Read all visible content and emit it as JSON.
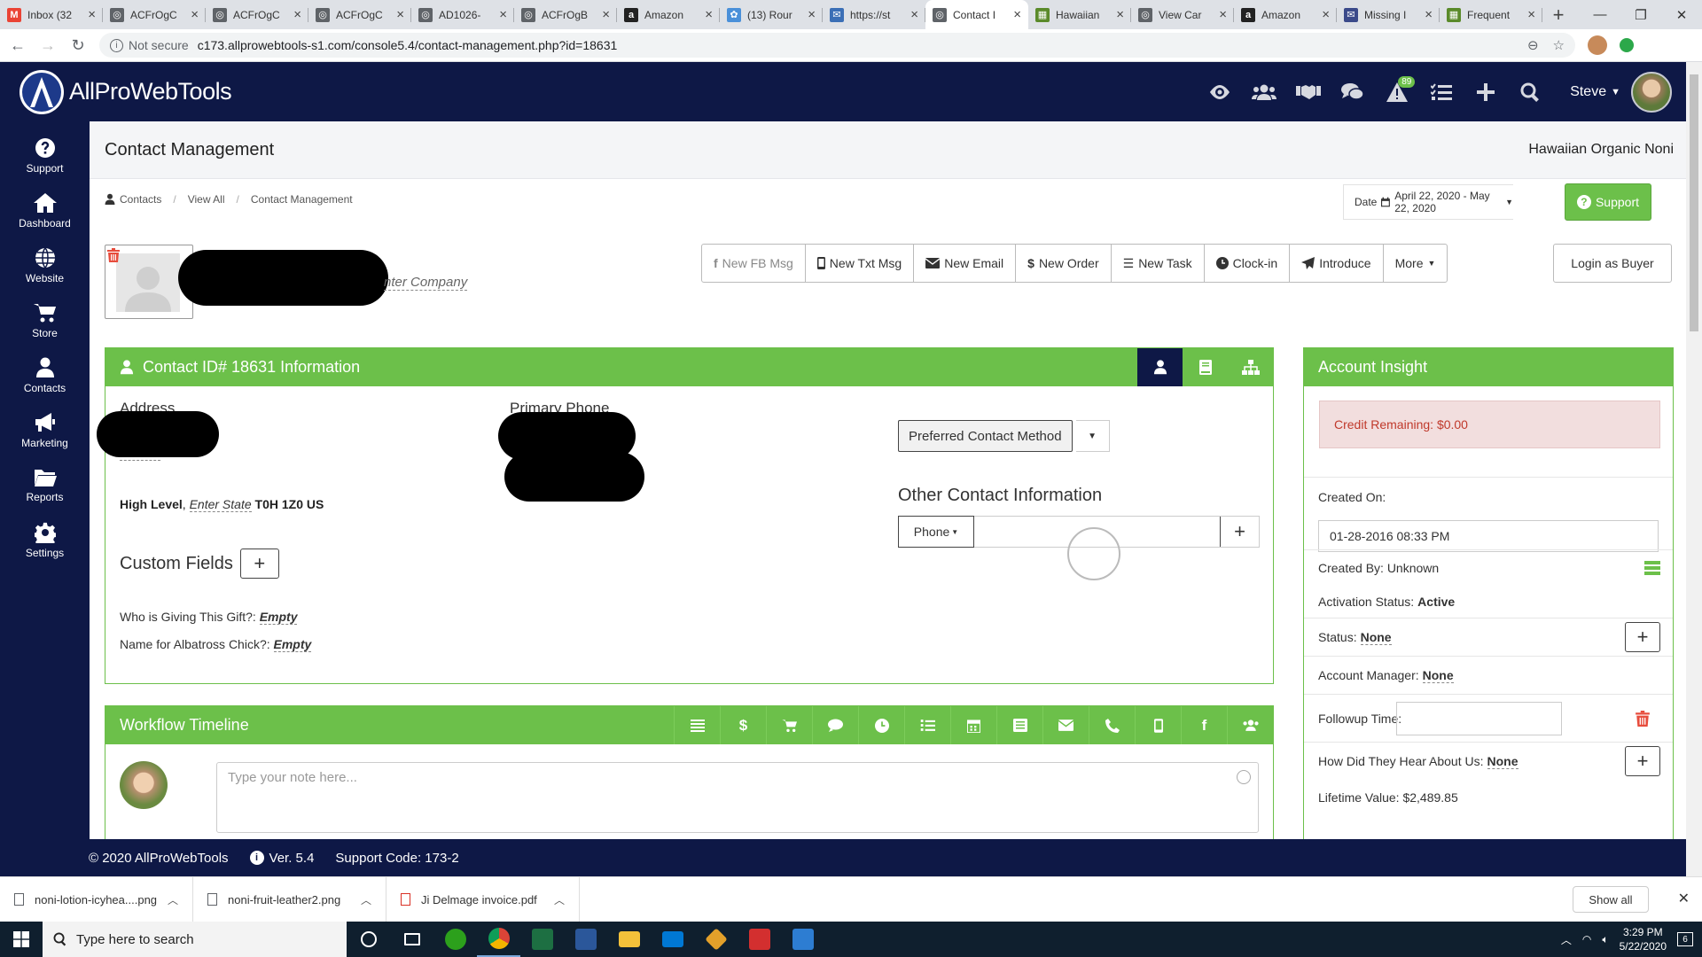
{
  "browser": {
    "tabs": [
      {
        "label": "Inbox (32",
        "icon": "gmail-icon",
        "color": "#ea4335",
        "glyph": "M"
      },
      {
        "label": "ACFrOgC",
        "icon": "globe-icon",
        "color": "#5f6368",
        "glyph": "◎"
      },
      {
        "label": "ACFrOgC",
        "icon": "globe-icon",
        "color": "#5f6368",
        "glyph": "◎"
      },
      {
        "label": "ACFrOgC",
        "icon": "globe-icon",
        "color": "#5f6368",
        "glyph": "◎"
      },
      {
        "label": "AD1026-",
        "icon": "globe-icon",
        "color": "#5f6368",
        "glyph": "◎"
      },
      {
        "label": "ACFrOgB",
        "icon": "globe-icon",
        "color": "#5f6368",
        "glyph": "◎"
      },
      {
        "label": "Amazon",
        "icon": "amazon-icon",
        "color": "#222",
        "glyph": "a"
      },
      {
        "label": "(13) Rour",
        "icon": "pinwheel-icon",
        "color": "#4a90d9",
        "glyph": "✿"
      },
      {
        "label": "https://st",
        "icon": "mail-icon",
        "color": "#3b6fb6",
        "glyph": "✉"
      },
      {
        "label": "Contact I",
        "icon": "globe-icon",
        "color": "#5f6368",
        "glyph": "◎",
        "active": true
      },
      {
        "label": "Hawaiian",
        "icon": "noni-icon",
        "color": "#5a8a2a",
        "glyph": "▦"
      },
      {
        "label": "View Car",
        "icon": "globe-icon",
        "color": "#5f6368",
        "glyph": "◎"
      },
      {
        "label": "Amazon",
        "icon": "amazon-icon",
        "color": "#222",
        "glyph": "a"
      },
      {
        "label": "Missing I",
        "icon": "mail-icon",
        "color": "#3b4a8a",
        "glyph": "✉"
      },
      {
        "label": "Frequent",
        "icon": "noni-icon",
        "color": "#5a8a2a",
        "glyph": "▦"
      }
    ],
    "not_secure": "Not secure",
    "url": "c173.allprowebtools-s1.com/console5.4/contact-management.php?id=18631"
  },
  "header": {
    "brand": "AllProWebTools",
    "badge_count": "89",
    "user": "Steve"
  },
  "sidebar": {
    "items": [
      {
        "label": "Support",
        "icon": "question-icon"
      },
      {
        "label": "Dashboard",
        "icon": "home-icon"
      },
      {
        "label": "Website",
        "icon": "globe-icon"
      },
      {
        "label": "Store",
        "icon": "cart-icon"
      },
      {
        "label": "Contacts",
        "icon": "person-icon"
      },
      {
        "label": "Marketing",
        "icon": "bullhorn-icon"
      },
      {
        "label": "Reports",
        "icon": "folder-icon"
      },
      {
        "label": "Settings",
        "icon": "gear-icon"
      }
    ]
  },
  "page": {
    "title": "Contact Management",
    "org": "Hawaiian Organic Noni",
    "breadcrumb": [
      "Contacts",
      "View All",
      "Contact Management"
    ],
    "date_label": "Date",
    "date_range": "April 22, 2020 - May 22, 2020",
    "support_button": "Support",
    "enter_company": "nter Company",
    "actions": [
      "New FB Msg",
      "New Txt Msg",
      "New Email",
      "New Order",
      "New Task",
      "Clock-in",
      "Introduce",
      "More"
    ],
    "login_as_buyer": "Login as Buyer"
  },
  "info": {
    "title": "Contact ID# 18631 Information",
    "address_label": "Address",
    "enter_address": "Enter A",
    "address_city": "High Level",
    "address_state": "Enter State",
    "address_zip": "T0H 1Z0 US",
    "primary_phone_label": "Primary Phone",
    "preferred_contact": "Preferred Contact Method",
    "other_contact_label": "Other Contact Information",
    "other_contact_type": "Phone",
    "custom_fields_label": "Custom Fields",
    "custom_fields": [
      {
        "label": "Who is Giving This Gift?:",
        "value": "Empty"
      },
      {
        "label": "Name for Albatross Chick?:",
        "value": "Empty"
      }
    ]
  },
  "workflow": {
    "title": "Workflow Timeline",
    "note_placeholder": "Type your note here..."
  },
  "account": {
    "title": "Account Insight",
    "credit": "Credit Remaining: $0.00",
    "created_on_label": "Created On:",
    "created_on": "01-28-2016 08:33 PM",
    "created_by": "Created By: Unknown",
    "activation_label": "Activation Status:",
    "activation": "Active",
    "status_label": "Status:",
    "status": "None",
    "manager_label": "Account Manager:",
    "manager": "None",
    "followup_label": "Followup Time:",
    "hear_label": "How Did They Hear About Us:",
    "hear": "None",
    "lifetime": "Lifetime Value: $2,489.85"
  },
  "footer": {
    "copyright": "© 2020 AllProWebTools",
    "version": "Ver. 5.4",
    "support_code": "Support Code: 173-2"
  },
  "downloads": {
    "items": [
      "noni-lotion-icyhea....png",
      "noni-fruit-leather2.png",
      "Ji Delmage invoice.pdf"
    ],
    "show_all": "Show all"
  },
  "taskbar": {
    "search_placeholder": "Type here to search",
    "time": "3:29 PM",
    "date": "5/22/2020",
    "notif_count": "6"
  },
  "colors": {
    "navy": "#0e1846",
    "green": "#6cc04a",
    "danger": "#c0392b"
  }
}
